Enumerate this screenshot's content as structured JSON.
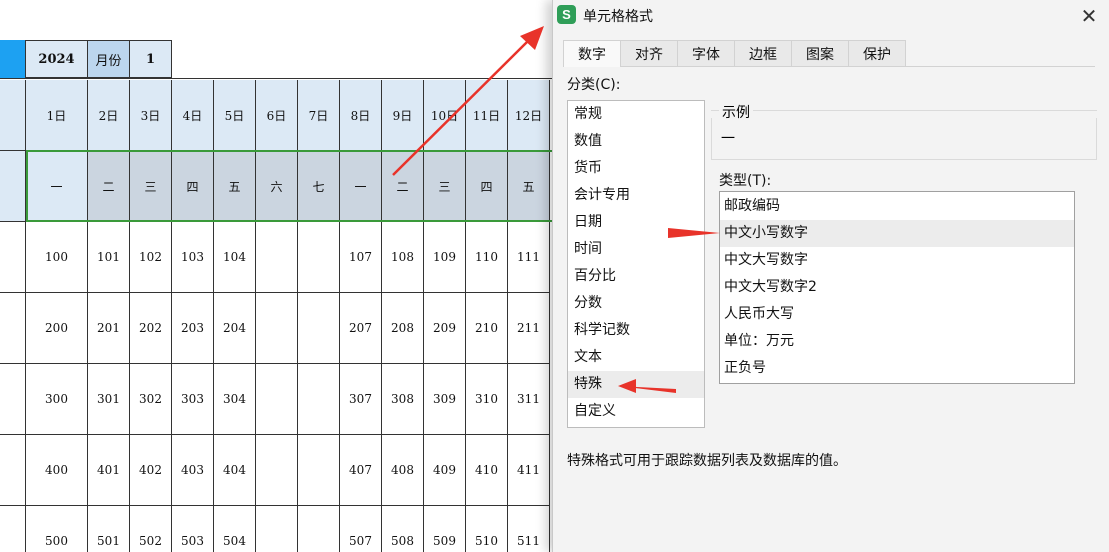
{
  "sheet": {
    "year": "2024",
    "month_label": "月份",
    "month_value": "1",
    "days": [
      "1日",
      "2日",
      "3日",
      "4日",
      "5日",
      "6日",
      "7日",
      "8日",
      "9日",
      "10日",
      "11日",
      "12日"
    ],
    "weekdays": [
      "一",
      "二",
      "三",
      "四",
      "五",
      "六",
      "七",
      "一",
      "二",
      "三",
      "四",
      "五"
    ],
    "rows": [
      [
        "100",
        "101",
        "102",
        "103",
        "104",
        "",
        "",
        "107",
        "108",
        "109",
        "110",
        "111"
      ],
      [
        "200",
        "201",
        "202",
        "203",
        "204",
        "",
        "",
        "207",
        "208",
        "209",
        "210",
        "211"
      ],
      [
        "300",
        "301",
        "302",
        "303",
        "304",
        "",
        "",
        "307",
        "308",
        "309",
        "310",
        "311"
      ],
      [
        "400",
        "401",
        "402",
        "403",
        "404",
        "",
        "",
        "407",
        "408",
        "409",
        "410",
        "411"
      ],
      [
        "500",
        "501",
        "502",
        "503",
        "504",
        "",
        "",
        "507",
        "508",
        "509",
        "510",
        "511"
      ]
    ]
  },
  "dialog": {
    "app_icon": "S",
    "title": "单元格格式",
    "close": "✕",
    "tabs": [
      "数字",
      "对齐",
      "字体",
      "边框",
      "图案",
      "保护"
    ],
    "active_tab": "数字",
    "category_label": "分类(C):",
    "categories": [
      "常规",
      "数值",
      "货币",
      "会计专用",
      "日期",
      "时间",
      "百分比",
      "分数",
      "科学记数",
      "文本",
      "特殊",
      "自定义"
    ],
    "selected_category": "特殊",
    "example_label": "示例",
    "example_value": "一",
    "type_label": "类型(T):",
    "types": [
      "邮政编码",
      "中文小写数字",
      "中文大写数字",
      "中文大写数字2",
      "人民币大写",
      "单位：万元",
      "正负号"
    ],
    "selected_type": "中文小写数字",
    "description": "特殊格式可用于跟踪数据列表及数据库的值。"
  },
  "colors": {
    "annotation_arrow": "#e8332a",
    "header_bg": "#dce9f5",
    "weekday_bg": "#cbd5e0",
    "selection_outline": "#3a9a3a",
    "accent_blue": "#1da1f2"
  }
}
